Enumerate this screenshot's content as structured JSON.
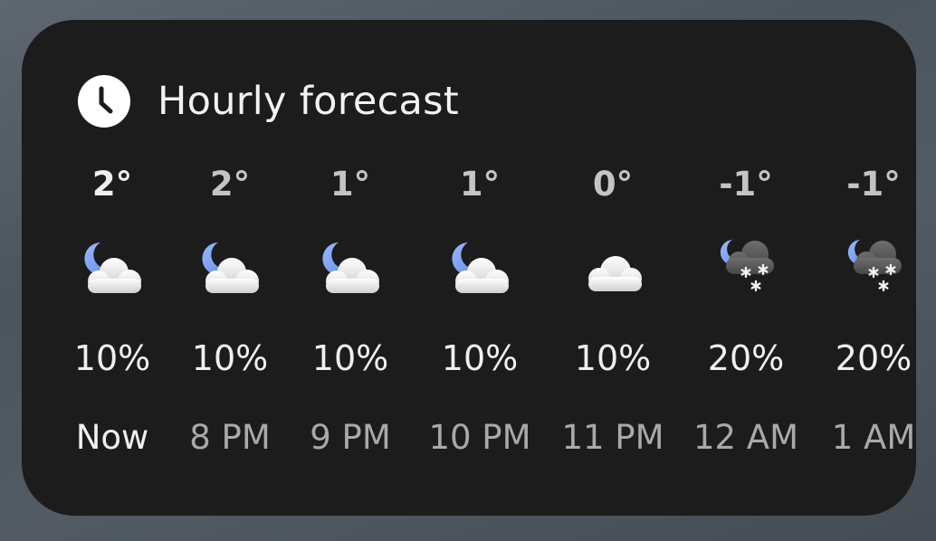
{
  "widget": {
    "title": "Hourly forecast",
    "header_icon": "clock-icon",
    "hours": [
      {
        "time": "Now",
        "temp": "2°",
        "precip": "10%",
        "icon": "partly-cloudy-night-icon"
      },
      {
        "time": "8 PM",
        "temp": "2°",
        "precip": "10%",
        "icon": "partly-cloudy-night-icon"
      },
      {
        "time": "9 PM",
        "temp": "1°",
        "precip": "10%",
        "icon": "partly-cloudy-night-icon"
      },
      {
        "time": "10 PM",
        "temp": "1°",
        "precip": "10%",
        "icon": "partly-cloudy-night-icon"
      },
      {
        "time": "11 PM",
        "temp": "0°",
        "precip": "10%",
        "icon": "cloudy-icon"
      },
      {
        "time": "12 AM",
        "temp": "-1°",
        "precip": "20%",
        "icon": "snow-night-icon"
      },
      {
        "time": "1 AM",
        "temp": "-1°",
        "precip": "20%",
        "icon": "snow-night-icon"
      }
    ]
  },
  "colors": {
    "card_background": "#1c1c1c",
    "moon": "#7fa4f5",
    "cloud_light": "#e9e9e9",
    "cloud_dark": "#5b5b5b"
  }
}
